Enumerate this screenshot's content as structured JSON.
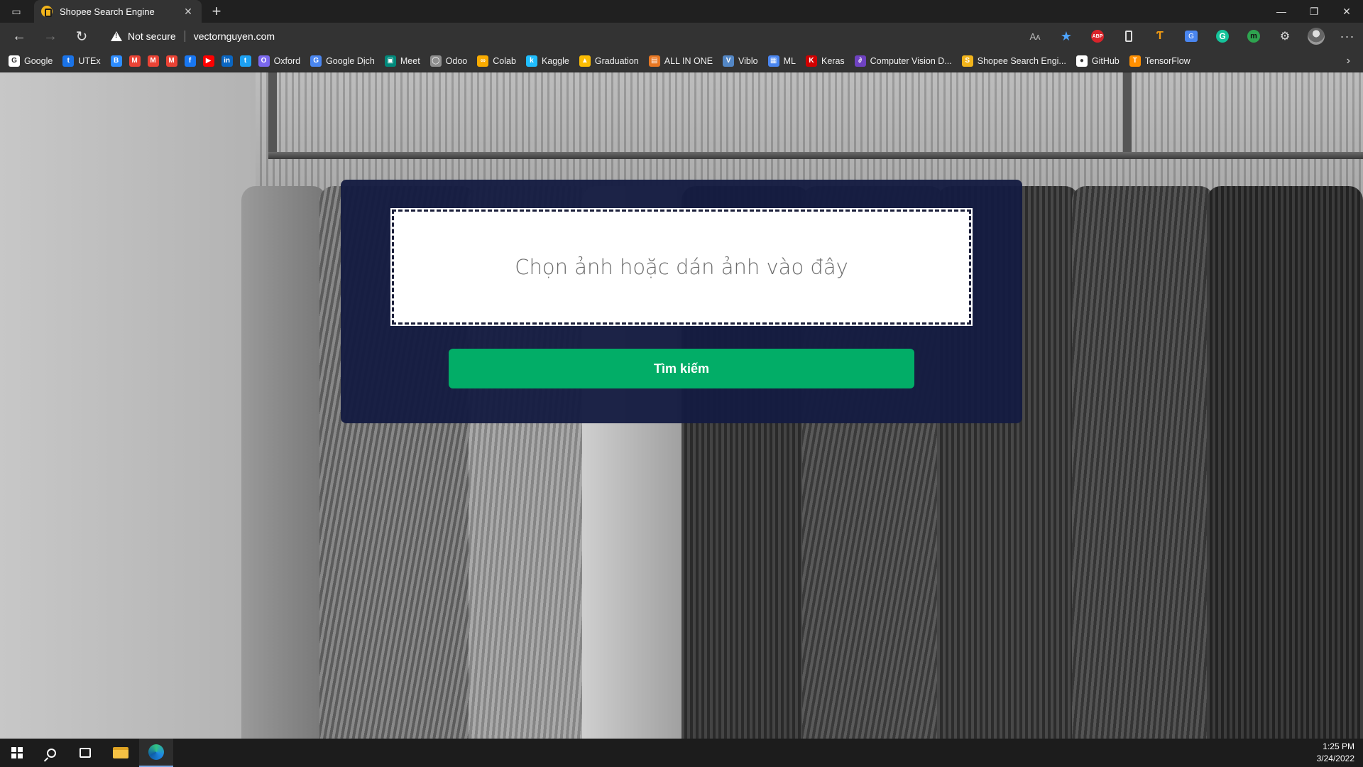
{
  "browser": {
    "tab": {
      "title": "Shopee Search Engine"
    },
    "security_label": "Not secure",
    "url": "vectornguyen.com",
    "read_aloud": "Aᴀ",
    "bookmarks": [
      {
        "label": "Google",
        "icon": "google-icon",
        "color": "#ffffff"
      },
      {
        "label": "UTEx",
        "icon": "utex-icon",
        "color": "#1a73e8"
      },
      {
        "label": "",
        "icon": "bookmark-b-icon",
        "color": "#2d8cff"
      },
      {
        "label": "",
        "icon": "gmail-icon",
        "color": "#ea4335"
      },
      {
        "label": "",
        "icon": "gmail-icon",
        "color": "#ea4335"
      },
      {
        "label": "",
        "icon": "gmail-icon",
        "color": "#ea4335"
      },
      {
        "label": "",
        "icon": "facebook-icon",
        "color": "#1877f2"
      },
      {
        "label": "",
        "icon": "youtube-icon",
        "color": "#ff0000"
      },
      {
        "label": "",
        "icon": "linkedin-icon",
        "color": "#0a66c2"
      },
      {
        "label": "",
        "icon": "twitter-icon",
        "color": "#1da1f2"
      },
      {
        "label": "Oxford",
        "icon": "oxford-icon",
        "color": "#7b68ee"
      },
      {
        "label": "Google Dịch",
        "icon": "google-translate-icon",
        "color": "#4a86f0"
      },
      {
        "label": "Meet",
        "icon": "meet-icon",
        "color": "#00897b"
      },
      {
        "label": "Odoo",
        "icon": "odoo-icon",
        "color": "#8f8f8f"
      },
      {
        "label": "Colab",
        "icon": "colab-icon",
        "color": "#f9ab00"
      },
      {
        "label": "Kaggle",
        "icon": "kaggle-icon",
        "color": "#20beff"
      },
      {
        "label": "Graduation",
        "icon": "drive-icon",
        "color": "#fbbc04"
      },
      {
        "label": "ALL IN ONE",
        "icon": "folder-icon",
        "color": "#e87722"
      },
      {
        "label": "Viblo",
        "icon": "viblo-icon",
        "color": "#5387c6"
      },
      {
        "label": "ML",
        "icon": "ml-icon",
        "color": "#4a86f0"
      },
      {
        "label": "Keras",
        "icon": "keras-icon",
        "color": "#d00000"
      },
      {
        "label": "Computer Vision D...",
        "icon": "cv-icon",
        "color": "#6f42c1"
      },
      {
        "label": "Shopee Search Engi...",
        "icon": "shopee-icon",
        "color": "#f2b41b"
      },
      {
        "label": "GitHub",
        "icon": "github-icon",
        "color": "#ffffff"
      },
      {
        "label": "TensorFlow",
        "icon": "tensorflow-icon",
        "color": "#ff8f00"
      }
    ]
  },
  "main": {
    "dropzone_text": "Chọn ảnh hoặc dán ảnh vào đây",
    "search_button": "Tìm kiếm"
  },
  "taskbar": {
    "time": "1:25 PM",
    "date": "3/24/2022"
  },
  "colors": {
    "panel": "#151c42",
    "search_button": "#02ad67"
  }
}
